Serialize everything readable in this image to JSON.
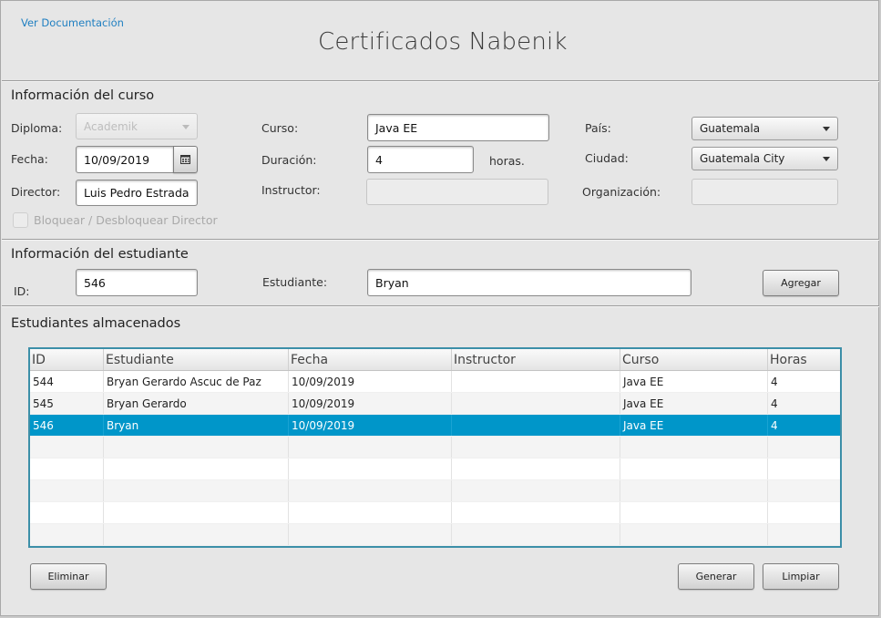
{
  "header": {
    "doc_link": "Ver Documentación",
    "title": "Certificados Nabenik"
  },
  "course": {
    "section_title": "Información del curso",
    "diploma": {
      "label": "Diploma:",
      "value": "Academik"
    },
    "fecha": {
      "label": "Fecha:",
      "value": "10/09/2019",
      "icon": "calendar-icon"
    },
    "director": {
      "label": "Director:",
      "value": "Luis Pedro Estrada"
    },
    "lock_director": {
      "label": "Bloquear / Desbloquear Director",
      "checked": false
    },
    "curso": {
      "label": "Curso:",
      "value": "Java EE"
    },
    "duracion": {
      "label": "Duración:",
      "value": "4",
      "unit": "horas."
    },
    "instructor": {
      "label": "Instructor:",
      "value": ""
    },
    "pais": {
      "label": "País:",
      "value": "Guatemala"
    },
    "ciudad": {
      "label": "Ciudad:",
      "value": "Guatemala City"
    },
    "organizacion": {
      "label": "Organización:",
      "value": ""
    }
  },
  "student": {
    "section_title": "Información del estudiante",
    "id": {
      "label": "ID:",
      "value": "546"
    },
    "estudiante": {
      "label": "Estudiante:",
      "value": "Bryan"
    },
    "add_label": "Agregar"
  },
  "stored": {
    "section_title": "Estudiantes almacenados",
    "columns": [
      "ID",
      "Estudiante",
      "Fecha",
      "Instructor",
      "Curso",
      "Horas"
    ],
    "rows": [
      [
        "544",
        "Bryan Gerardo Ascuc de Paz",
        "10/09/2019",
        "",
        "Java EE",
        "4"
      ],
      [
        "545",
        "Bryan Gerardo",
        "10/09/2019",
        "",
        "Java EE",
        "4"
      ],
      [
        "546",
        "Bryan",
        "10/09/2019",
        "",
        "Java EE",
        "4"
      ]
    ],
    "selected_row": 2
  },
  "actions": {
    "delete_label": "Eliminar",
    "generate_label": "Generar",
    "clear_label": "Limpiar"
  },
  "colors": {
    "selection": "#0096c9",
    "link": "#1f7fc1",
    "table_border": "#3c8fa8"
  }
}
